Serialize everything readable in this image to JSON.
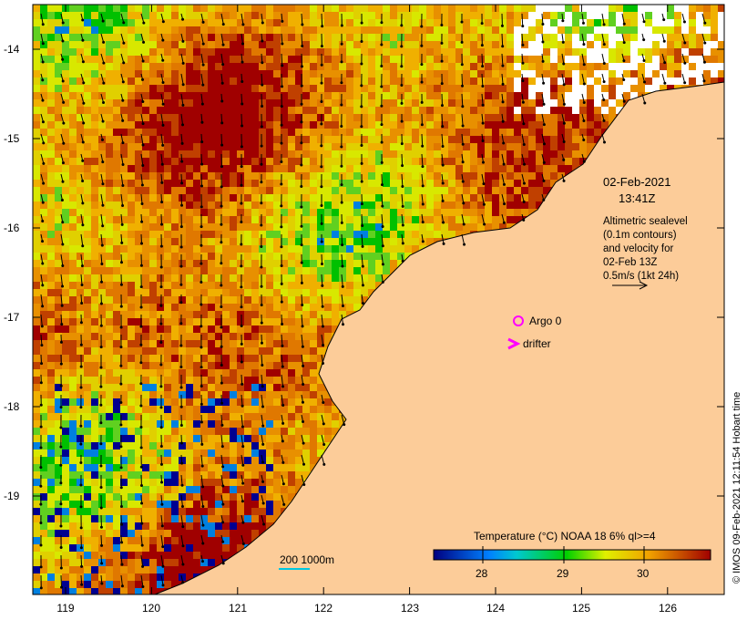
{
  "map": {
    "x_ticks": [
      "119",
      "120",
      "121",
      "122",
      "123",
      "124",
      "125",
      "126"
    ],
    "y_ticks": [
      "-14",
      "-15",
      "-16",
      "-17",
      "-18",
      "-19"
    ],
    "date": "02-Feb-2021",
    "time": "13:41Z",
    "legend_lines": [
      "Altimetric sealevel",
      "(0.1m contours)",
      "and velocity for",
      "02-Feb 13Z",
      "0.5m/s (1kt 24h)"
    ],
    "argo_label": "Argo 0",
    "drifter_label": "drifter",
    "scale_label": "200  1000m",
    "colorbar": {
      "title": "Temperature (°C) NOAA 18 6% ql>=4",
      "ticks": [
        "28",
        "29",
        "30"
      ],
      "range": [
        27.4,
        30.8
      ]
    },
    "credit": "© IMOS 09-Feb-2021 12:11:54 Hobart time",
    "colors": {
      "land": "#fccc99",
      "argo": "#ff00ff",
      "drifter": "#ff00ff"
    }
  }
}
